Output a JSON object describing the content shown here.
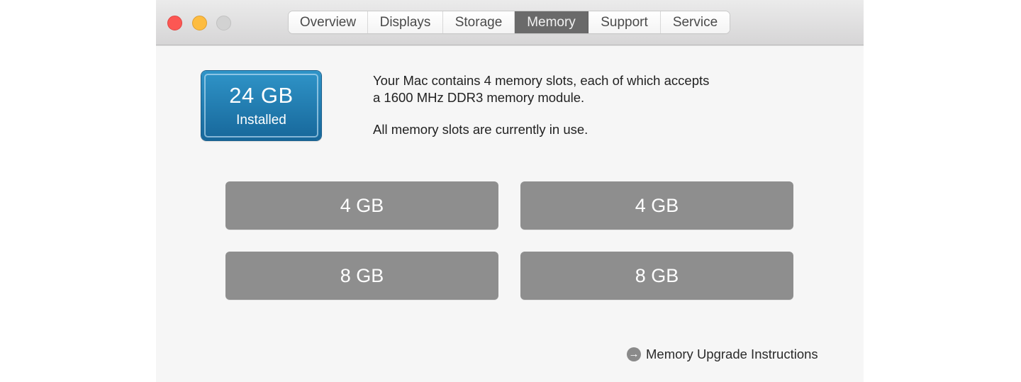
{
  "window": {
    "traffic_lights": [
      {
        "name": "close",
        "color": "#fc5753"
      },
      {
        "name": "minimize",
        "color": "#fdbc40"
      },
      {
        "name": "zoom",
        "color": "#d2d2d2"
      }
    ]
  },
  "tabs": [
    {
      "label": "Overview",
      "active": false
    },
    {
      "label": "Displays",
      "active": false
    },
    {
      "label": "Storage",
      "active": false
    },
    {
      "label": "Memory",
      "active": true
    },
    {
      "label": "Support",
      "active": false
    },
    {
      "label": "Service",
      "active": false
    }
  ],
  "memory": {
    "installed_amount": "24 GB",
    "installed_label": "Installed",
    "accent_color": "#2180b4",
    "description_line1": "Your Mac contains 4 memory slots, each of which accepts",
    "description_line2": "a 1600 MHz DDR3 memory module.",
    "status": "All memory slots are currently in use.",
    "slots": [
      {
        "size": "4 GB"
      },
      {
        "size": "4 GB"
      },
      {
        "size": "8 GB"
      },
      {
        "size": "8 GB"
      }
    ],
    "upgrade_link": {
      "icon": "arrow-circle-right-icon",
      "label": "Memory Upgrade Instructions"
    }
  }
}
